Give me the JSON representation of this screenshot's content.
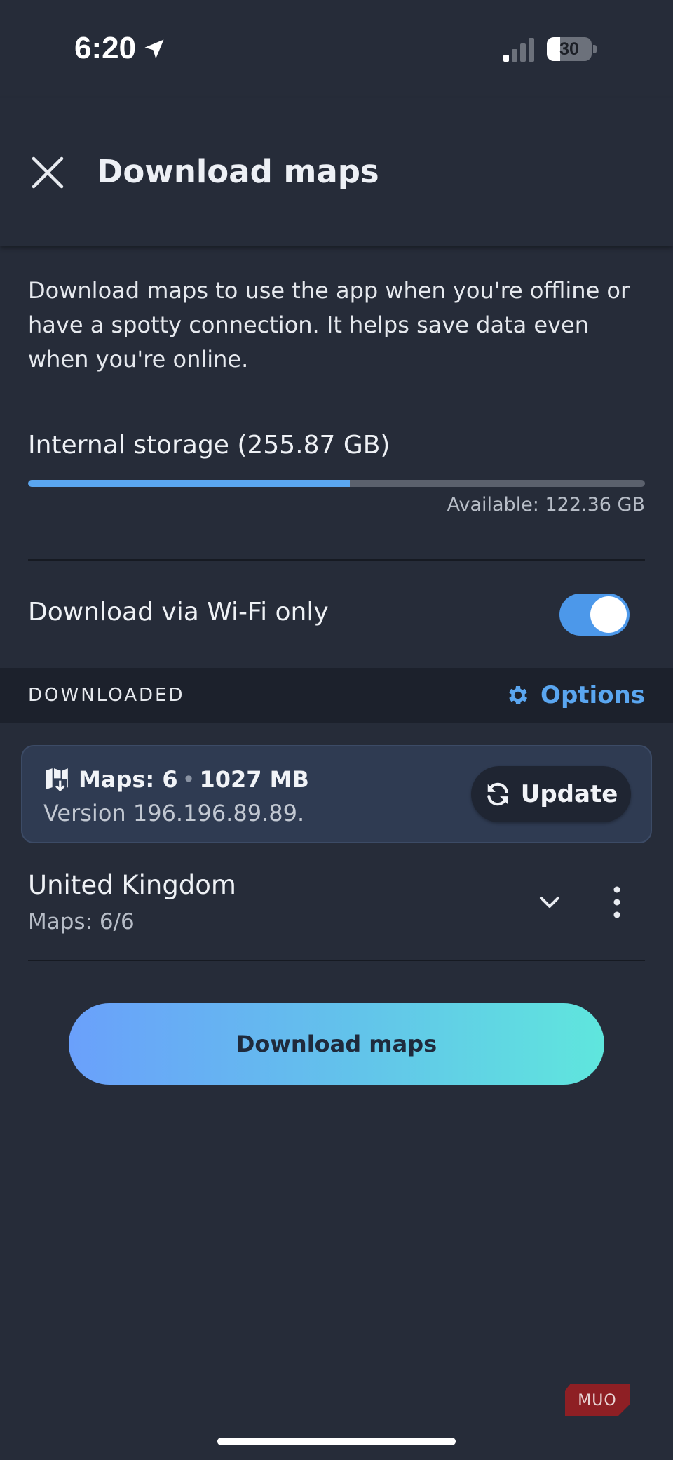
{
  "status_bar": {
    "time": "6:20",
    "battery_level": "30",
    "battery_percent": 30,
    "location_icon": "location-arrow-icon",
    "signal_icon": "cellular-signal-icon"
  },
  "header": {
    "title": "Download maps",
    "close_icon": "close-icon"
  },
  "intro_text": "Download maps to use the app when you're offline or have a spotty connection. It helps save data even when you're online.",
  "storage": {
    "label": "Internal storage (255.87 GB)",
    "available": "Available: 122.36 GB",
    "used_fraction": 0.522
  },
  "wifi_only": {
    "label": "Download via Wi-Fi only",
    "enabled": true
  },
  "downloaded_section": {
    "title": "DOWNLOADED",
    "options_label": "Options",
    "options_icon": "gear-icon"
  },
  "maps_summary": {
    "count": "Maps: 6",
    "size": "1027 MB",
    "version": "Version 196.196.89.89.",
    "update_label": "Update",
    "map_icon": "map-download-icon",
    "update_icon": "refresh-icon"
  },
  "regions": [
    {
      "name": "United Kingdom",
      "maps": "Maps: 6/6"
    }
  ],
  "download_button": "Download maps",
  "watermark": "MUO",
  "colors": {
    "background": "#262c39",
    "accent": "#5aa6f0",
    "section_bg": "#1c212c",
    "card_bg": "#2f3b52"
  }
}
